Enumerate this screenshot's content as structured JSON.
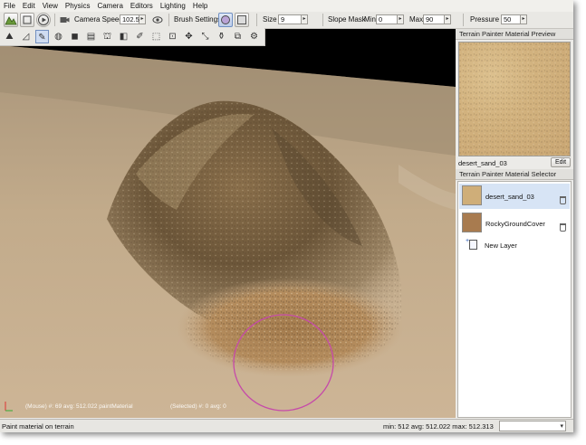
{
  "menu": [
    "File",
    "Edit",
    "View",
    "Physics",
    "Camera",
    "Editors",
    "Lighting",
    "Help"
  ],
  "toolbar": {
    "camera_speed_label": "Camera Speed",
    "camera_speed_value": "102.5",
    "brush_settings_label": "Brush Settings",
    "size_label": "Size",
    "size_value": "9",
    "slope_mask_label": "Slope Mask",
    "min_label": "Min",
    "min_value": "0",
    "max_label": "Max",
    "max_value": "90",
    "pressure_label": "Pressure",
    "pressure_value": "50",
    "spin_glyph": "▸"
  },
  "viewport": {
    "mouse_info": "(Mouse) #: 69  avg: 512.022  paintMaterial",
    "selected_info": "(Selected) #: 0  avg: 0"
  },
  "preview_panel": {
    "title": "Terrain Painter Material Preview",
    "material_name": "desert_sand_03",
    "edit_label": "Edit"
  },
  "selector_panel": {
    "title": "Terrain Painter Material Selector",
    "materials": [
      {
        "name": "desert_sand_03",
        "color": "#cfae79"
      },
      {
        "name": "RockyGroundCover",
        "color": "#a87b4f"
      }
    ],
    "new_layer_label": "New Layer"
  },
  "status": {
    "text": "Paint material on terrain",
    "stats": "min: 512  avg: 512.022  max: 512.313"
  },
  "colors": {
    "accent_brush_circle": "#c64aa9",
    "selection": "#d7e4f5"
  }
}
